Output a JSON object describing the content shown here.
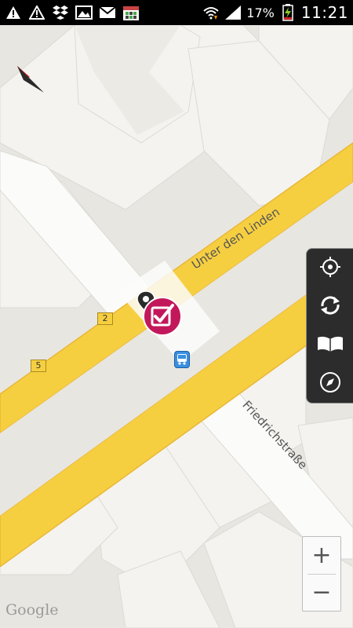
{
  "status_bar": {
    "battery_percent": "17%",
    "time": "11:21",
    "icons": [
      "warning-icon",
      "warning-icon",
      "dropbox-icon",
      "image-icon",
      "gmail-icon",
      "calendar-icon",
      "wifi-icon",
      "signal-icon",
      "battery-charging-icon"
    ]
  },
  "map": {
    "streets": {
      "main_street": "Unter den Linden",
      "cross_street": "Friedrichstraße"
    },
    "route_badges": [
      "2",
      "5"
    ],
    "attribution": "Google"
  },
  "controls": {
    "side_panel": [
      "locate-icon",
      "sync-icon",
      "map-book-icon",
      "compass-icon"
    ],
    "zoom_in": "+",
    "zoom_out": "−"
  },
  "colors": {
    "road_yellow": "#f6cf41",
    "road_border": "#e9b736",
    "background": "#e8e6e1",
    "building": "#f3f2ee",
    "marker_pink": "#c2185b",
    "panel_dark": "#2c2c2c"
  }
}
